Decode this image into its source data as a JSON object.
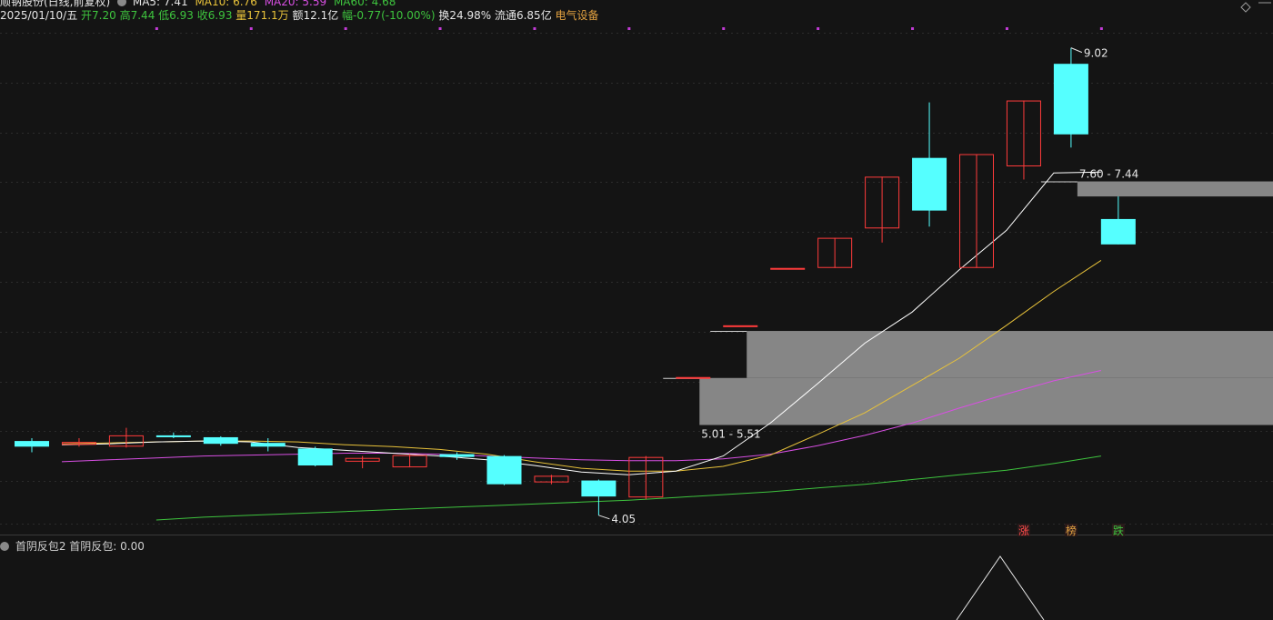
{
  "header": {
    "line1": {
      "stock_name": "顺钠股份(日线,前复权)",
      "ma5": "MA5: 7.41",
      "ma10": "MA10: 6.76",
      "ma20": "MA20: 5.59",
      "ma60": "MA60: 4.68"
    },
    "line2": {
      "date": "2025/01/10/五",
      "open": "开7.20",
      "high": "高7.44",
      "low": "低6.93",
      "close": "收6.93",
      "volume": "量171.1万",
      "amount": "额12.1亿",
      "change": "幅-0.77(-10.00%)",
      "turnover": "换24.98%",
      "float_cap": "流通6.85亿",
      "sector": "电气设备"
    }
  },
  "colors": {
    "up": "#ff3b3b",
    "down": "#55ffff",
    "ma5": "#ffffff",
    "ma10": "#e8c23a",
    "ma20": "#d84fe3",
    "ma60": "#3ec43e",
    "zone": "#868686",
    "grid": "#2c2c2c",
    "marker": "#c23bd6"
  },
  "chart_data": {
    "type": "candlestick",
    "y_axis": {
      "min": 4.0,
      "max": 9.2
    },
    "candles": [
      {
        "open": 4.84,
        "close": 4.78,
        "high": 4.87,
        "low": 4.72
      },
      {
        "open": 4.8,
        "close": 4.83,
        "high": 4.87,
        "low": 4.78
      },
      {
        "open": 4.78,
        "close": 4.9,
        "high": 4.98,
        "low": 4.77
      },
      {
        "open": 4.9,
        "close": 4.88,
        "high": 4.93,
        "low": 4.87
      },
      {
        "open": 4.88,
        "close": 4.81,
        "high": 4.89,
        "low": 4.79
      },
      {
        "open": 4.82,
        "close": 4.78,
        "high": 4.87,
        "low": 4.73
      },
      {
        "open": 4.76,
        "close": 4.58,
        "high": 4.78,
        "low": 4.57
      },
      {
        "open": 4.62,
        "close": 4.66,
        "high": 4.68,
        "low": 4.55
      },
      {
        "open": 4.56,
        "close": 4.69,
        "high": 4.7,
        "low": 4.56
      },
      {
        "open": 4.7,
        "close": 4.67,
        "high": 4.72,
        "low": 4.64
      },
      {
        "open": 4.68,
        "close": 4.38,
        "high": 4.69,
        "low": 4.37
      },
      {
        "open": 4.4,
        "close": 4.47,
        "high": 4.48,
        "low": 4.38
      },
      {
        "open": 4.42,
        "close": 4.25,
        "high": 4.43,
        "low": 4.05
      },
      {
        "open": 4.24,
        "close": 4.67,
        "high": 4.68,
        "low": 4.22
      },
      {
        "open": 5.52,
        "close": 5.52,
        "high": 5.52,
        "low": 5.52
      },
      {
        "open": 6.07,
        "close": 6.07,
        "high": 6.07,
        "low": 6.07
      },
      {
        "open": 6.68,
        "close": 6.68,
        "high": 6.68,
        "low": 6.68
      },
      {
        "open": 6.68,
        "close": 7.0,
        "high": 7.0,
        "low": 6.68
      },
      {
        "open": 7.1,
        "close": 7.65,
        "high": 7.65,
        "low": 6.95
      },
      {
        "open": 7.85,
        "close": 7.29,
        "high": 8.44,
        "low": 7.12
      },
      {
        "open": 6.68,
        "close": 7.89,
        "high": 7.89,
        "low": 6.68
      },
      {
        "open": 7.76,
        "close": 8.46,
        "high": 8.46,
        "low": 7.62
      },
      {
        "open": 8.85,
        "close": 8.1,
        "high": 9.02,
        "low": 7.96
      },
      {
        "open": 7.2,
        "close": 6.93,
        "high": 7.44,
        "low": 6.93
      }
    ],
    "ma5": [
      null,
      4.8,
      4.81,
      4.83,
      4.84,
      4.83,
      4.77,
      4.74,
      4.71,
      4.68,
      4.64,
      4.58,
      4.51,
      4.48,
      4.52,
      4.68,
      5.03,
      5.45,
      5.88,
      6.21,
      6.66,
      7.08,
      7.69,
      7.7
    ],
    "ma10": [
      4.81,
      4.82,
      4.83,
      4.84,
      4.84,
      4.83,
      4.8,
      4.78,
      4.75,
      4.7,
      4.62,
      4.55,
      4.52,
      4.52,
      4.57,
      4.69,
      4.91,
      5.14,
      5.43,
      5.72,
      6.07,
      6.43,
      6.76
    ],
    "ma20": [
      4.62,
      4.64,
      4.66,
      4.68,
      4.69,
      4.7,
      4.71,
      4.71,
      4.7,
      4.68,
      4.66,
      4.64,
      4.63,
      4.63,
      4.65,
      4.7,
      4.79,
      4.9,
      5.03,
      5.19,
      5.34,
      5.48,
      5.59
    ],
    "ma60": [
      4.0,
      4.03,
      4.05,
      4.07,
      4.09,
      4.11,
      4.13,
      4.15,
      4.17,
      4.19,
      4.21,
      4.24,
      4.27,
      4.3,
      4.34,
      4.38,
      4.43,
      4.48,
      4.53,
      4.6,
      4.68
    ],
    "zones": [
      {
        "low": 7.44,
        "high": 7.6,
        "from": 22.5,
        "label": "7.60 - 7.44"
      },
      {
        "low": 5.51,
        "high": 6.01,
        "from": 15.5,
        "label": "5.51 - 6.01"
      },
      {
        "low": 5.01,
        "high": 5.51,
        "from": 14.5,
        "label": "5.01 - 5.51"
      }
    ],
    "high_label": "9.02",
    "low_label": "4.05",
    "badges": [
      "涨",
      "榜",
      "跌"
    ],
    "indicator": {
      "name": "首阴反包2",
      "label": "首阴反包:",
      "value": "0.00",
      "spike_at": 20.5
    }
  }
}
